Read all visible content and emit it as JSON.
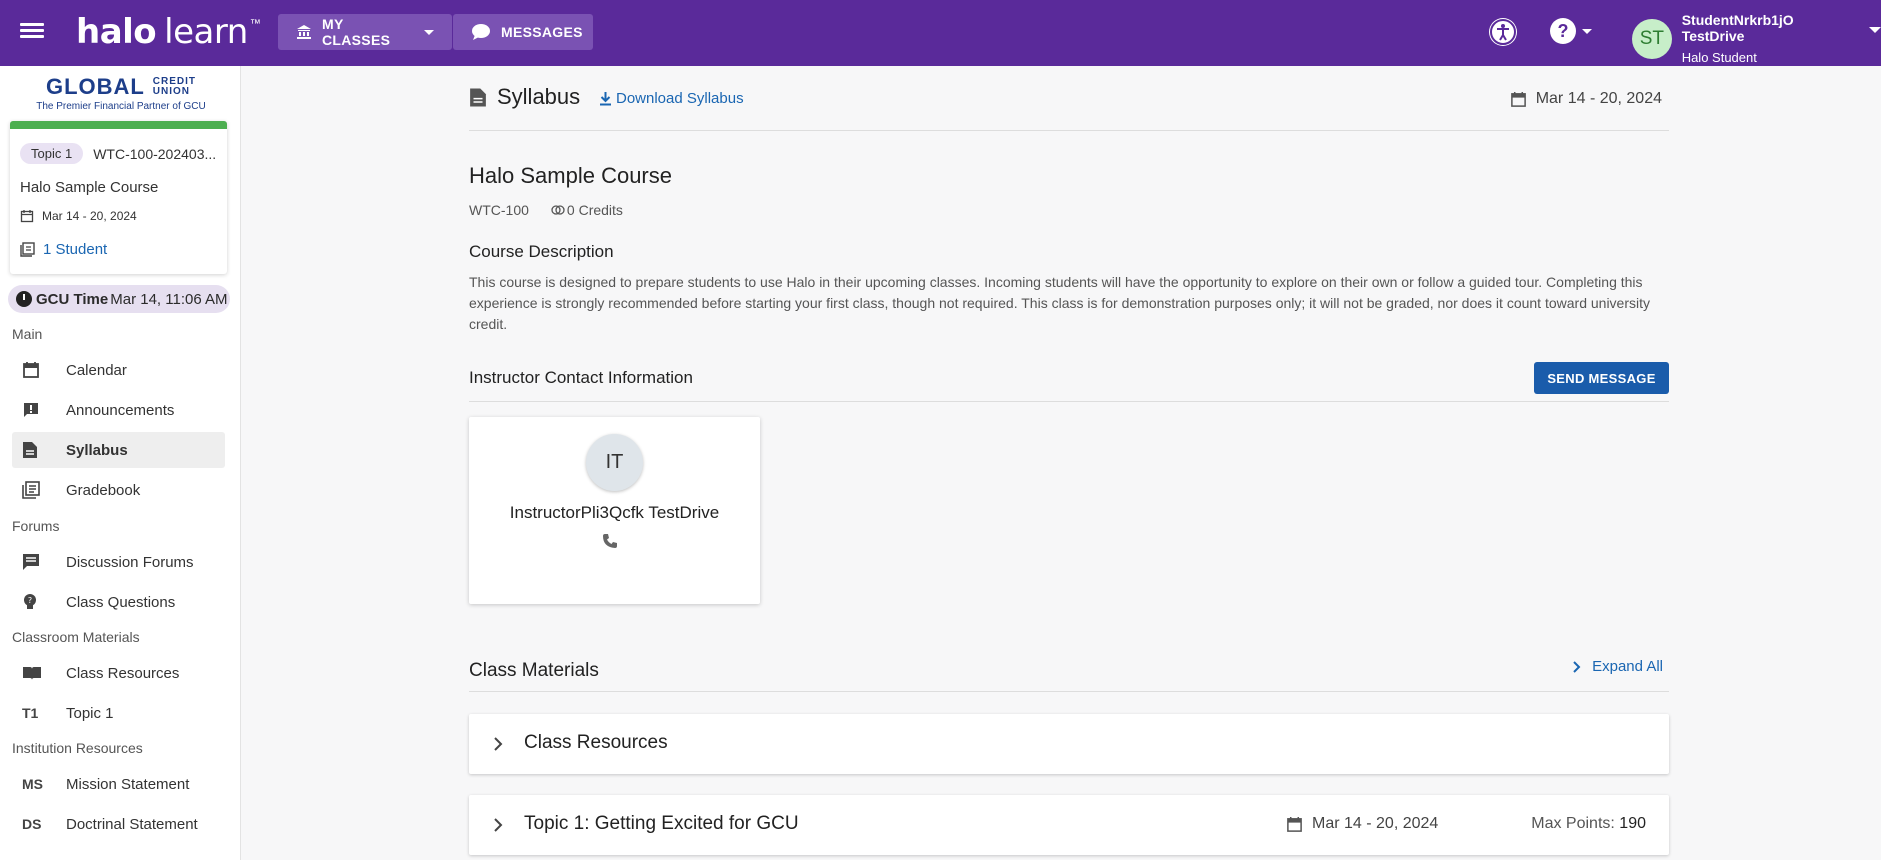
{
  "topbar": {
    "logo_halo": "halo",
    "logo_learn": "learn",
    "logo_tm": "™",
    "my_classes": "MY CLASSES",
    "messages": "MESSAGES",
    "help": "?",
    "user_initials": "ST",
    "user_name": "StudentNrkrb1jO TestDrive",
    "user_role": "Halo Student",
    "brand_color": "#5a2a9a"
  },
  "sidebar": {
    "partner_logo": {
      "big": "GLOBAL",
      "small_top": "CREDIT",
      "small_bottom": "UNION",
      "tagline": "The Premier Financial Partner of GCU"
    },
    "course_card": {
      "topic_chip": "Topic 1",
      "code": "WTC-100-202403...",
      "name": "Halo Sample Course",
      "dates": "Mar 14 - 20, 2024",
      "students": "1 Student"
    },
    "gcu_time_label": "GCU Time",
    "gcu_time_value": "Mar 14, 11:06 AM",
    "sections": {
      "main": "Main",
      "forums": "Forums",
      "classroom": "Classroom Materials",
      "institution": "Institution Resources"
    },
    "items": {
      "calendar": "Calendar",
      "announcements": "Announcements",
      "syllabus": "Syllabus",
      "gradebook": "Gradebook",
      "discussion": "Discussion Forums",
      "questions": "Class Questions",
      "resources": "Class Resources",
      "topic1": "Topic 1",
      "topic1_abbr": "T1",
      "mission": "Mission Statement",
      "mission_abbr": "MS",
      "doctrinal": "Doctrinal Statement",
      "doctrinal_abbr": "DS"
    }
  },
  "main": {
    "page_title": "Syllabus",
    "download": "Download Syllabus",
    "date_range": "Mar 14 - 20, 2024",
    "course_title": "Halo Sample Course",
    "course_code": "WTC-100",
    "credits": "0 Credits",
    "desc_heading": "Course Description",
    "description": "This course is designed to prepare students to use Halo in their upcoming classes. Incoming students will have the opportunity to explore on their own or follow a guided tour. Completing this experience is strongly recommended before starting your first class, though not required. This class is for demonstration purposes only; it will not be graded, nor does it count toward university credit.",
    "instructor_heading": "Instructor Contact Information",
    "send_message": "SEND MESSAGE",
    "instructor": {
      "initials": "IT",
      "name": "InstructorPli3Qcfk TestDrive"
    },
    "materials_heading": "Class Materials",
    "expand_all": "Expand All",
    "accordions": [
      {
        "title": "Class Resources"
      },
      {
        "title": "Topic 1: Getting Excited for GCU",
        "dates": "Mar 14 - 20, 2024",
        "max_points_label": "Max Points:",
        "max_points": "190"
      }
    ]
  }
}
